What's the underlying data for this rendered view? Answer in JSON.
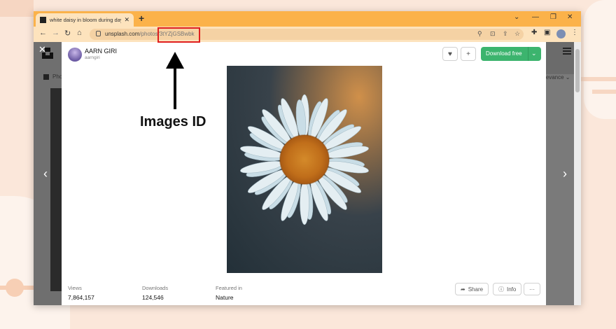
{
  "browser": {
    "tab_title": "white daisy in bloom during day",
    "tab_close": "✕",
    "new_tab": "+",
    "window_controls": [
      "⌄",
      "—",
      "❐",
      "✕"
    ],
    "url_host": "unsplash.com",
    "url_path": "/photos/",
    "url_id": "3tYZjGSBwbk"
  },
  "page": {
    "close_symbol": "✕",
    "background_tab_label": "Pho",
    "relevance_label": "levance ⌄",
    "prev_arrow": "‹",
    "next_arrow": "›"
  },
  "modal": {
    "author_name": "AARN GIRI",
    "author_handle": "aarngiri",
    "like_icon": "♥",
    "add_icon": "+",
    "download_label": "Download free",
    "download_chevron": "⌄",
    "stats": [
      {
        "label": "Views",
        "value": "7,864,157"
      },
      {
        "label": "Downloads",
        "value": "124,546"
      },
      {
        "label": "Featured in",
        "value": "Nature"
      }
    ],
    "share_label": "Share",
    "info_label": "Info",
    "more_label": "···"
  },
  "annotation": {
    "label": "Images ID"
  },
  "colors": {
    "tabbar": "#fbb24a",
    "toolbar": "#fde3bd",
    "download_green": "#3cb46e",
    "highlight_red": "#e01e1e",
    "background": "#fbe7da"
  }
}
